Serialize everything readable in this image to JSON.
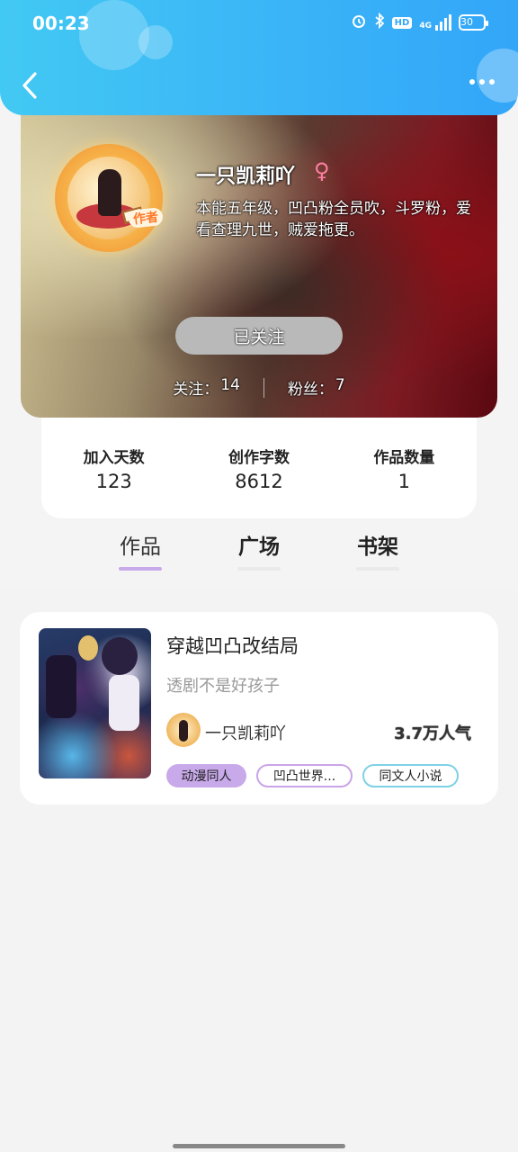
{
  "status_bar": {
    "time": "00:23",
    "network": "4G",
    "hd": "HD",
    "battery": "30"
  },
  "header": {
    "back_icon": "chevron-left-icon",
    "more_icon": "more-dots-icon"
  },
  "profile": {
    "author_badge": "作者",
    "nickname": "一只凯莉吖",
    "gender_symbol": "♀",
    "bio": "本能五年级，凹凸粉全员吹，斗罗粉，爱看查理九世，贼爱拖更。",
    "follow_button": "已关注",
    "following_label": "关注：",
    "following_count": "14",
    "followers_label": "粉丝：",
    "followers_count": "7"
  },
  "stats": [
    {
      "label": "加入天数",
      "value": "123"
    },
    {
      "label": "创作字数",
      "value": "8612"
    },
    {
      "label": "作品数量",
      "value": "1"
    }
  ],
  "tabs": [
    {
      "label": "作品",
      "active": true
    },
    {
      "label": "广场",
      "active": false
    },
    {
      "label": "书架",
      "active": false
    }
  ],
  "work": {
    "title": "穿越凹凸改结局",
    "description": "透剧不是好孩子",
    "author": "一只凯莉吖",
    "popularity": "3.7万人气",
    "tags": [
      "动漫同人",
      "凹凸世界...",
      "同文人小说"
    ]
  },
  "colors": {
    "header_start": "#42c9f3",
    "header_end": "#33a6f8",
    "tab_active": "#c8a9ea",
    "gender": "#ff7ea0"
  }
}
